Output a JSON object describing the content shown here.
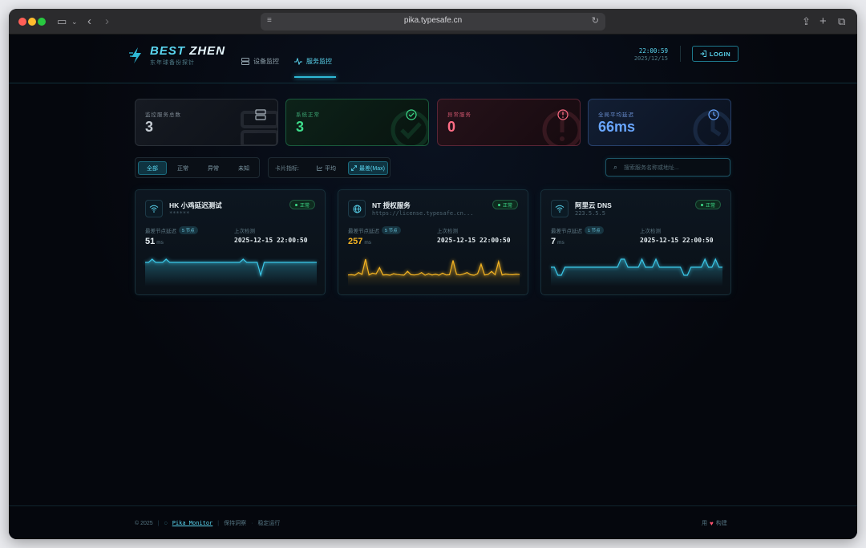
{
  "browser": {
    "url": "pika.typesafe.cn"
  },
  "header": {
    "logo_part1": "BEST",
    "logo_part2": "ZHEN",
    "logo_sub": "东年球备份探针",
    "nav": [
      {
        "label": "设备监控",
        "icon": "server-icon"
      },
      {
        "label": "服务监控",
        "icon": "activity-icon",
        "active": true
      }
    ],
    "time": "22:00:59",
    "date": "2025/12/15",
    "login_label": "LOGIN"
  },
  "stats": [
    {
      "label": "监控服务总数",
      "value": "3",
      "icon": "server-icon",
      "color": "#c5ccd3"
    },
    {
      "label": "系统正常",
      "value": "3",
      "icon": "check-circle-icon",
      "color": "#3ddc8a"
    },
    {
      "label": "异常服务",
      "value": "0",
      "icon": "alert-circle-icon",
      "color": "#ff6d85"
    },
    {
      "label": "全局平均延迟",
      "value": "66ms",
      "icon": "clock-icon",
      "color": "#69a6ff"
    }
  ],
  "filters": {
    "status": [
      "全部",
      "正常",
      "异常",
      "未知"
    ],
    "active_status": "全部",
    "metric_label": "卡片指标:",
    "metrics": [
      "平均",
      "最差(Max)"
    ],
    "active_metric": "最差(Max)",
    "search_placeholder": "搜索服务名称或地址..."
  },
  "cards": [
    {
      "name": "HK 小鸡延迟测试",
      "subtitle": "******",
      "icon": "wifi-icon",
      "status": "正常",
      "latency_label": "最差节点延迟",
      "nodes": "5 节点",
      "latency": "51",
      "unit": "ms",
      "check_label": "上次检测",
      "check_time": "2025-12-15 22:00:50",
      "line_color": "#3bc6e6",
      "series": [
        50,
        50,
        51,
        50,
        50,
        50,
        51,
        50,
        50,
        50,
        50,
        50,
        50,
        50,
        50,
        50,
        50,
        50,
        50,
        50,
        50,
        50,
        50,
        50,
        50,
        50,
        50,
        50,
        51,
        50,
        50,
        50,
        50,
        46,
        50,
        50,
        50,
        50,
        50,
        50,
        50,
        50,
        50,
        50,
        50,
        50,
        50,
        50,
        50,
        50
      ]
    },
    {
      "name": "NT 授权服务",
      "subtitle": "https://license.typesafe.cn...",
      "icon": "globe-icon",
      "status": "正常",
      "latency_label": "最差节点延迟",
      "nodes": "5 节点",
      "latency": "257",
      "unit": "ms",
      "warn": true,
      "check_label": "上次检测",
      "check_time": "2025-12-15 22:00:50",
      "line_color": "#f5b423",
      "series": [
        120,
        122,
        118,
        140,
        125,
        250,
        120,
        135,
        128,
        180,
        120,
        122,
        118,
        130,
        124,
        121,
        119,
        150,
        122,
        120,
        124,
        140,
        118,
        130,
        120,
        126,
        118,
        135,
        120,
        122,
        240,
        125,
        120,
        128,
        140,
        122,
        118,
        130,
        210,
        120,
        124,
        150,
        122,
        230,
        120,
        128,
        124,
        122,
        126,
        124
      ]
    },
    {
      "name": "阿里云 DNS",
      "subtitle": "223.5.5.5",
      "icon": "wifi-icon",
      "status": "正常",
      "latency_label": "最差节点延迟",
      "nodes": "1 节点",
      "latency": "7",
      "unit": "ms",
      "check_label": "上次检测",
      "check_time": "2025-12-15 22:00:50",
      "line_color": "#3bc6e6",
      "series": [
        6,
        6,
        5,
        5,
        6,
        6,
        6,
        6,
        6,
        6,
        6,
        6,
        6,
        6,
        6,
        6,
        6,
        6,
        6,
        6,
        7,
        7,
        6,
        6,
        6,
        6,
        7,
        6,
        6,
        6,
        7,
        6,
        6,
        6,
        6,
        6,
        6,
        6,
        5,
        5,
        6,
        6,
        6,
        6,
        7,
        6,
        6,
        7,
        6,
        6
      ]
    }
  ],
  "footer": {
    "copyright": "© 2025",
    "brand": "Pika Monitor",
    "tagline1": "保持洞察",
    "tagline2": "稳定运行",
    "right_prefix": "用",
    "right_suffix": "构建"
  }
}
